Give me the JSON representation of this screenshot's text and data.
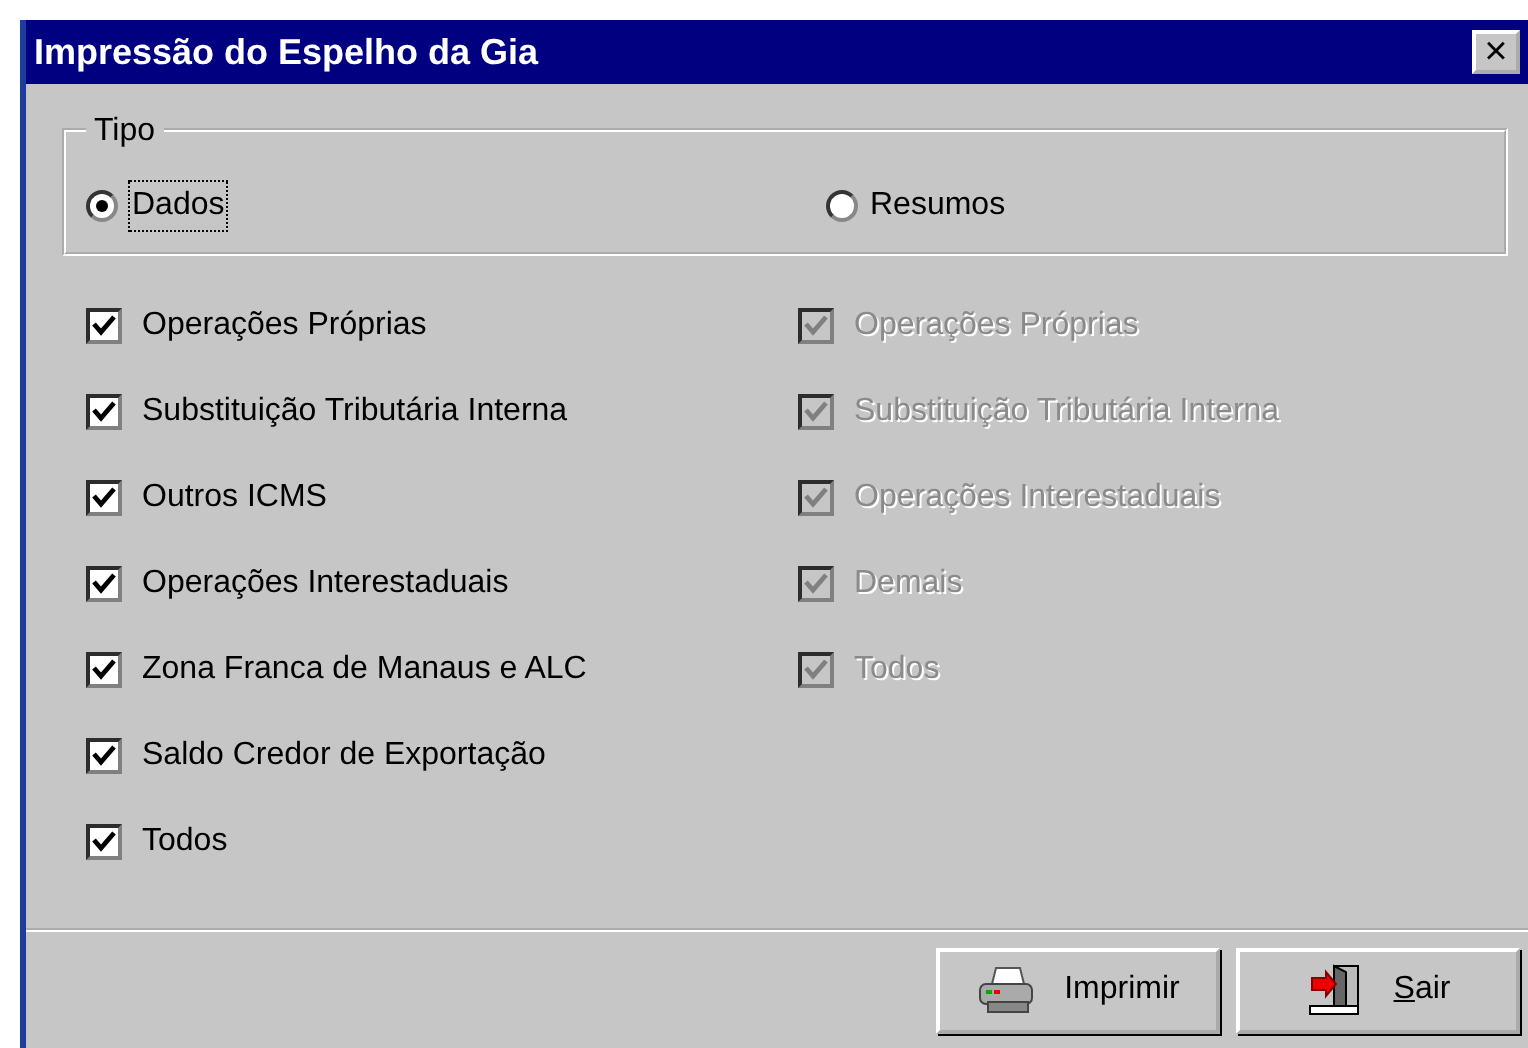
{
  "window": {
    "title": "Impressão do Espelho da Gia",
    "close_button": "×"
  },
  "tipo": {
    "label": "Tipo",
    "options": [
      {
        "label": "Dados",
        "selected": true,
        "focused": true
      },
      {
        "label": "Resumos",
        "selected": false,
        "focused": false
      }
    ]
  },
  "left_checks": [
    {
      "label": "Operações Próprias",
      "checked": true,
      "disabled": false
    },
    {
      "label": "Substituição Tributária Interna",
      "checked": true,
      "disabled": false
    },
    {
      "label": "Outros ICMS",
      "checked": true,
      "disabled": false
    },
    {
      "label": "Operações Interestaduais",
      "checked": true,
      "disabled": false
    },
    {
      "label": "Zona Franca de Manaus e ALC",
      "checked": true,
      "disabled": false
    },
    {
      "label": "Saldo Credor de Exportação",
      "checked": true,
      "disabled": false
    },
    {
      "label": "Todos",
      "checked": true,
      "disabled": false
    }
  ],
  "right_checks": [
    {
      "label": "Operações Próprias",
      "checked": true,
      "disabled": true
    },
    {
      "label": "Substituição Tributária Interna",
      "checked": true,
      "disabled": true
    },
    {
      "label": "Operações Interestaduais",
      "checked": true,
      "disabled": true
    },
    {
      "label": "Demais",
      "checked": true,
      "disabled": true
    },
    {
      "label": "Todos",
      "checked": true,
      "disabled": true
    }
  ],
  "buttons": [
    {
      "label": "Imprimir",
      "kind": "print",
      "mnemonic": false
    },
    {
      "label": "Sair",
      "kind": "exit",
      "mnemonic": true
    }
  ]
}
